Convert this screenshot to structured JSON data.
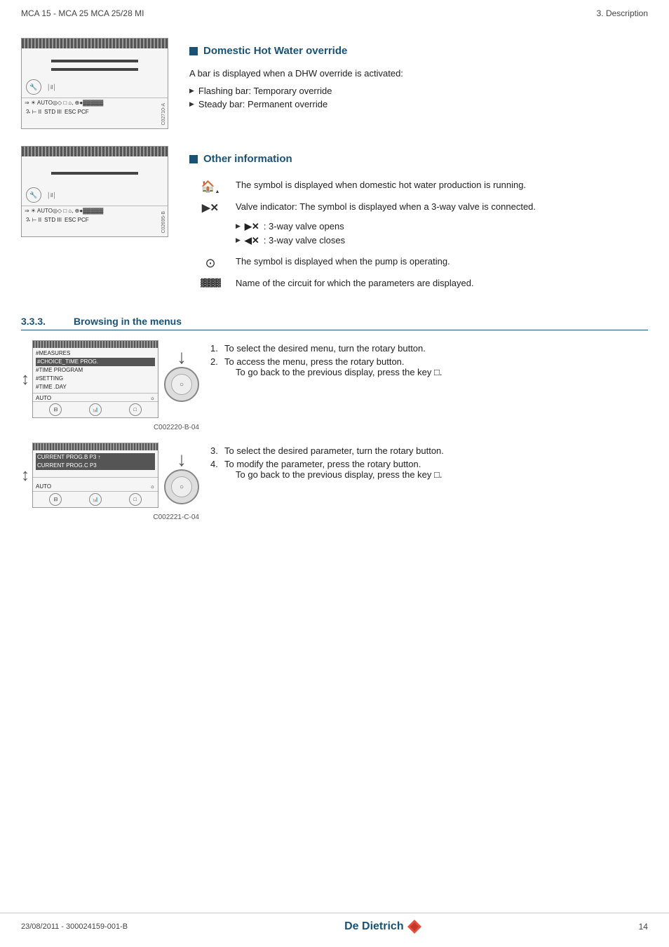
{
  "header": {
    "left": "MCA 15 - MCA 25 MCA 25/28 MI",
    "right": "3.  Description"
  },
  "footer": {
    "left": "23/08/2011  -  300024159-001-B",
    "center": "De Dietrich",
    "right": "14"
  },
  "section_dhw": {
    "heading": "Domestic Hot Water override",
    "description": "A bar is displayed when a DHW override is activated:",
    "bullets": [
      "Flashing bar: Temporary override",
      "Steady bar: Permanent override"
    ]
  },
  "section_other": {
    "heading": "Other information",
    "rows": [
      {
        "symbol": "DHW",
        "text": "The symbol is displayed when domestic hot water production is running."
      },
      {
        "symbol": "▶✕",
        "text": "Valve indicator: The symbol is displayed when a 3-way valve is connected.",
        "sub": [
          "▶✕ : 3-way valve opens",
          "◀✕ : 3-way valve closes"
        ]
      },
      {
        "symbol": "⊙",
        "text": "The symbol is displayed when the pump is operating."
      },
      {
        "symbol": "▓▓▓▓",
        "text": "Name of the circuit for which the parameters are displayed."
      }
    ]
  },
  "section_browsing": {
    "number": "3.3.3.",
    "heading": "Browsing in the menus",
    "steps_1_2": {
      "step1": "To select the desired menu, turn the rotary button.",
      "step2": "To access the menu, press the rotary button.",
      "step2_sub": "To go back to the previous display, press the key □."
    },
    "steps_3_4": {
      "step3": "To select the desired parameter, turn the rotary button.",
      "step4": "To modify the parameter, press the rotary button.",
      "step4_sub": "To go back to the previous display, press the key □."
    },
    "diagram1_label": "C002220-B-04",
    "diagram2_label": "C002221-C-04",
    "menu1_items": [
      {
        "text": "#MEASURES",
        "highlight": false
      },
      {
        "text": "#CHOICE_TIME PROG.",
        "highlight": true
      },
      {
        "text": "#TIME PROGRAM",
        "highlight": false
      },
      {
        "text": "#SETTING",
        "highlight": false
      },
      {
        "text": "#TIME .DAY",
        "highlight": false
      }
    ],
    "menu1_bottom": "AUTO    ☼",
    "menu2_items": [
      {
        "text": "CURRENT PROG.B    P3",
        "highlight": true
      },
      {
        "text": "CURRENT PROG.C    P3",
        "highlight": true
      }
    ],
    "menu2_bottom": "AUTO    ☼"
  }
}
